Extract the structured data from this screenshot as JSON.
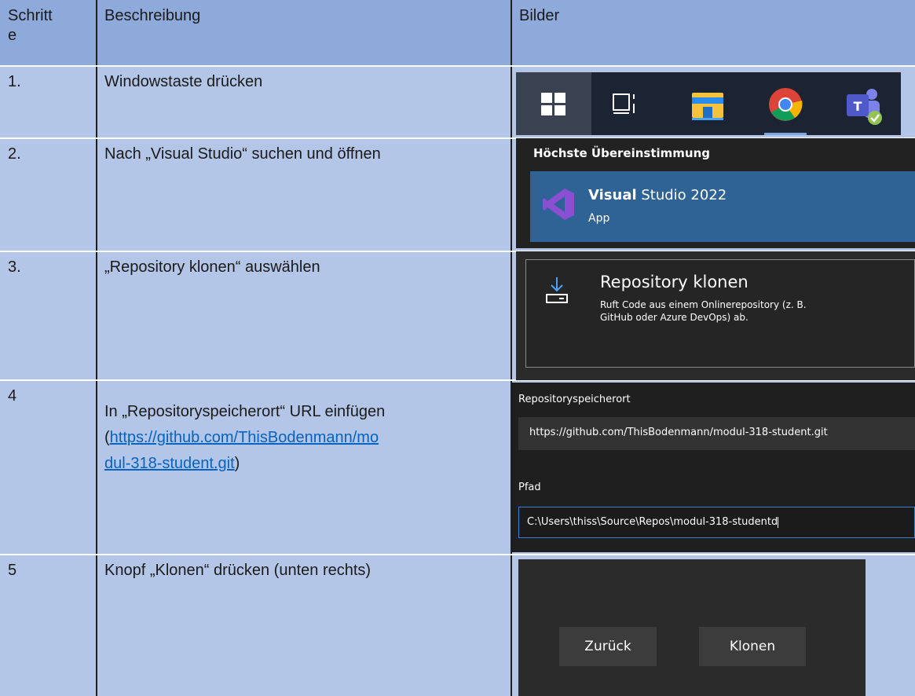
{
  "table": {
    "headers": [
      "Schritt\ne",
      "Beschreibung",
      "Bilder"
    ],
    "rows": [
      {
        "step": "1.",
        "desc": "Windowstaste drücken"
      },
      {
        "step": "2.",
        "desc": "Nach „Visual Studio“ suchen und öffnen"
      },
      {
        "step": "3.",
        "desc": "„Repository klonen“ auswählen"
      },
      {
        "step": "4",
        "desc_prefix": "In „Repositoryspeicherort“ URL einfügen",
        "desc_paren_open": "(",
        "link_line1": "https://github.com/ThisBodenmann/mo",
        "link_line2": "dul-318-student.git",
        "desc_paren_close": ")"
      },
      {
        "step": "5",
        "desc": "Knopf „Klonen“ drücken (unten rechts)"
      }
    ]
  },
  "screens": {
    "taskbar": {
      "icons": [
        "windows-start-icon",
        "task-view-icon",
        "file-explorer-icon",
        "chrome-icon",
        "teams-icon"
      ]
    },
    "search": {
      "heading": "Höchste Übereinstimmung",
      "app_bold": "Visual",
      "app_rest": " Studio 2022",
      "app_type": "App"
    },
    "clone_card": {
      "title": "Repository klonen",
      "desc_line1": "Ruft Code aus einem Onlinerepository (z. B.",
      "desc_line2": "GitHub oder Azure DevOps) ab."
    },
    "clone_form": {
      "repo_label": "Repositoryspeicherort",
      "repo_value": "https://github.com/ThisBodenmann/modul-318-student.git",
      "path_label": "Pfad",
      "path_value": "C:\\Users\\thiss\\Source\\Repos\\modul-318-studentd"
    },
    "buttons": {
      "back": "Zurück",
      "clone": "Klonen"
    }
  },
  "colors": {
    "header_bg": "#8eaadb",
    "row_bg": "#b4c6e7",
    "link": "#0563c1",
    "vs_purple": "#7b3fb0"
  }
}
